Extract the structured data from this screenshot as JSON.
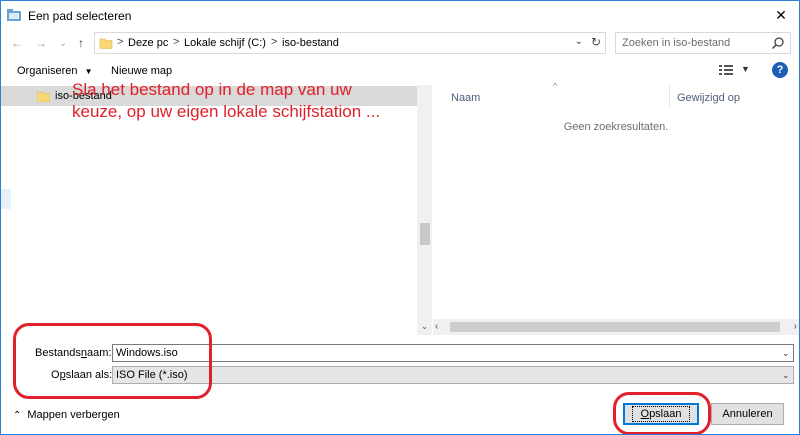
{
  "window": {
    "title": "Een pad selecteren"
  },
  "address": {
    "crumbs": [
      "Deze pc",
      "Lokale schijf (C:)",
      "iso-bestand"
    ],
    "separator": ">"
  },
  "search": {
    "placeholder": "Zoeken in iso-bestand"
  },
  "toolbar": {
    "organize_label": "Organiseren",
    "new_folder_label": "Nieuwe map"
  },
  "tree": {
    "selected_folder": "iso-bestand"
  },
  "annotation": {
    "text": "Sla het bestand op in de map van uw keuze, op uw eigen lokale schijfstation ..."
  },
  "filelist": {
    "columns": [
      "Naam",
      "Gewijzigd op"
    ],
    "empty_message": "Geen zoekresultaten."
  },
  "filename": {
    "label_before": "Bestands",
    "label_access": "n",
    "label_after": "aam:",
    "value": "Windows.iso"
  },
  "filetype": {
    "label_before": "O",
    "label_access": "p",
    "label_after": "slaan als:",
    "value": "ISO File (*.iso)"
  },
  "footer": {
    "hide_folders_label": "Mappen verbergen",
    "save_access": "O",
    "save_rest": "pslaan",
    "cancel_label": "Annuleren"
  },
  "colors": {
    "annotation_red": "#e0202a",
    "accent_blue": "#0078d7"
  }
}
